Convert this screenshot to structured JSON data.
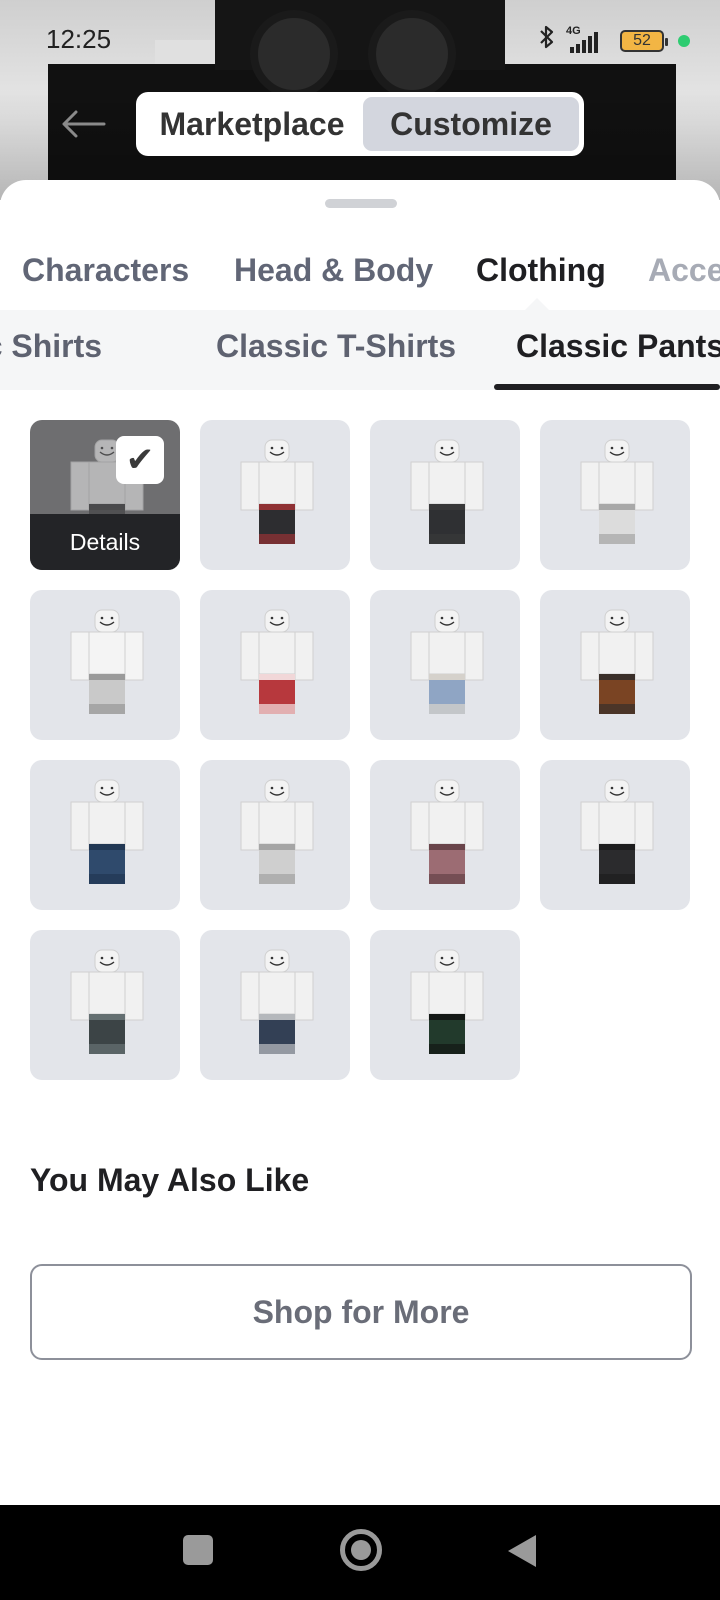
{
  "status_bar": {
    "time": "12:25",
    "network_label": "4G",
    "battery_level": "52",
    "icons": [
      "bluetooth-icon",
      "signal-icon",
      "battery-icon",
      "green-dot-icon"
    ]
  },
  "header": {
    "back_icon": "back-arrow-icon",
    "segments": [
      {
        "label": "Marketplace",
        "selected": false
      },
      {
        "label": "Customize",
        "selected": true
      }
    ]
  },
  "categories": {
    "tabs": [
      {
        "label": "Characters",
        "active": false
      },
      {
        "label": "Head & Body",
        "active": false
      },
      {
        "label": "Clothing",
        "active": true
      },
      {
        "label": "Acce",
        "active": false
      }
    ]
  },
  "subcategories": {
    "tabs": [
      {
        "label": "sic Shirts",
        "active": false
      },
      {
        "label": "Classic T-Shirts",
        "active": false
      },
      {
        "label": "Classic Pants",
        "active": true
      }
    ]
  },
  "items": {
    "details_label": "Details",
    "check_icon": "checkmark-icon",
    "list": [
      {
        "selected": true,
        "pants": "#3a3a3c",
        "shirt": "#f1f1f1",
        "accent": "#2a2a2a"
      },
      {
        "selected": false,
        "pants": "#2d2d30",
        "shirt": "#f1f1f1",
        "accent": "#a83236"
      },
      {
        "selected": false,
        "pants": "#2f3033",
        "shirt": "#f1f1f1",
        "accent": "#3b3b3b"
      },
      {
        "selected": false,
        "pants": "#dcdcdc",
        "shirt": "#f1f1f1",
        "accent": "#9b9b9b"
      },
      {
        "selected": false,
        "pants": "#c9c9c9",
        "shirt": "#f4f4f4",
        "accent": "#8f8f8f"
      },
      {
        "selected": false,
        "pants": "#b7383d",
        "shirt": "#f1f1f1",
        "accent": "#ffffff"
      },
      {
        "selected": false,
        "pants": "#8fa5c4",
        "shirt": "#f1f1f1",
        "accent": "#e6dccd"
      },
      {
        "selected": false,
        "pants": "#7a4423",
        "shirt": "#f1f1f1",
        "accent": "#2b2b2b"
      },
      {
        "selected": false,
        "pants": "#2f4a6c",
        "shirt": "#f1f1f1",
        "accent": "#1f334f"
      },
      {
        "selected": false,
        "pants": "#cfcfcf",
        "shirt": "#f1f1f1",
        "accent": "#9a9a9a"
      },
      {
        "selected": false,
        "pants": "#9c6c73",
        "shirt": "#f1f1f1",
        "accent": "#5c3b40"
      },
      {
        "selected": false,
        "pants": "#2b2b2d",
        "shirt": "#f1f1f1",
        "accent": "#1a1a1a"
      },
      {
        "selected": false,
        "pants": "#3c4446",
        "shirt": "#f1f1f1",
        "accent": "#6e7a7c"
      },
      {
        "selected": false,
        "pants": "#334055",
        "shirt": "#f1f1f1",
        "accent": "#d6d6d6"
      },
      {
        "selected": false,
        "pants": "#223a2c",
        "shirt": "#f1f1f1",
        "accent": "#111111"
      }
    ]
  },
  "recommendations": {
    "title": "You May Also Like",
    "shop_button": "Shop for More"
  },
  "nav_bar": {
    "icons": [
      "recents-icon",
      "home-icon",
      "back-icon"
    ]
  },
  "colors": {
    "accent_dark": "#1f1f22",
    "muted_text": "#616676",
    "card_bg": "#e3e5ea",
    "selected_card_bg": "#6e6e70"
  }
}
